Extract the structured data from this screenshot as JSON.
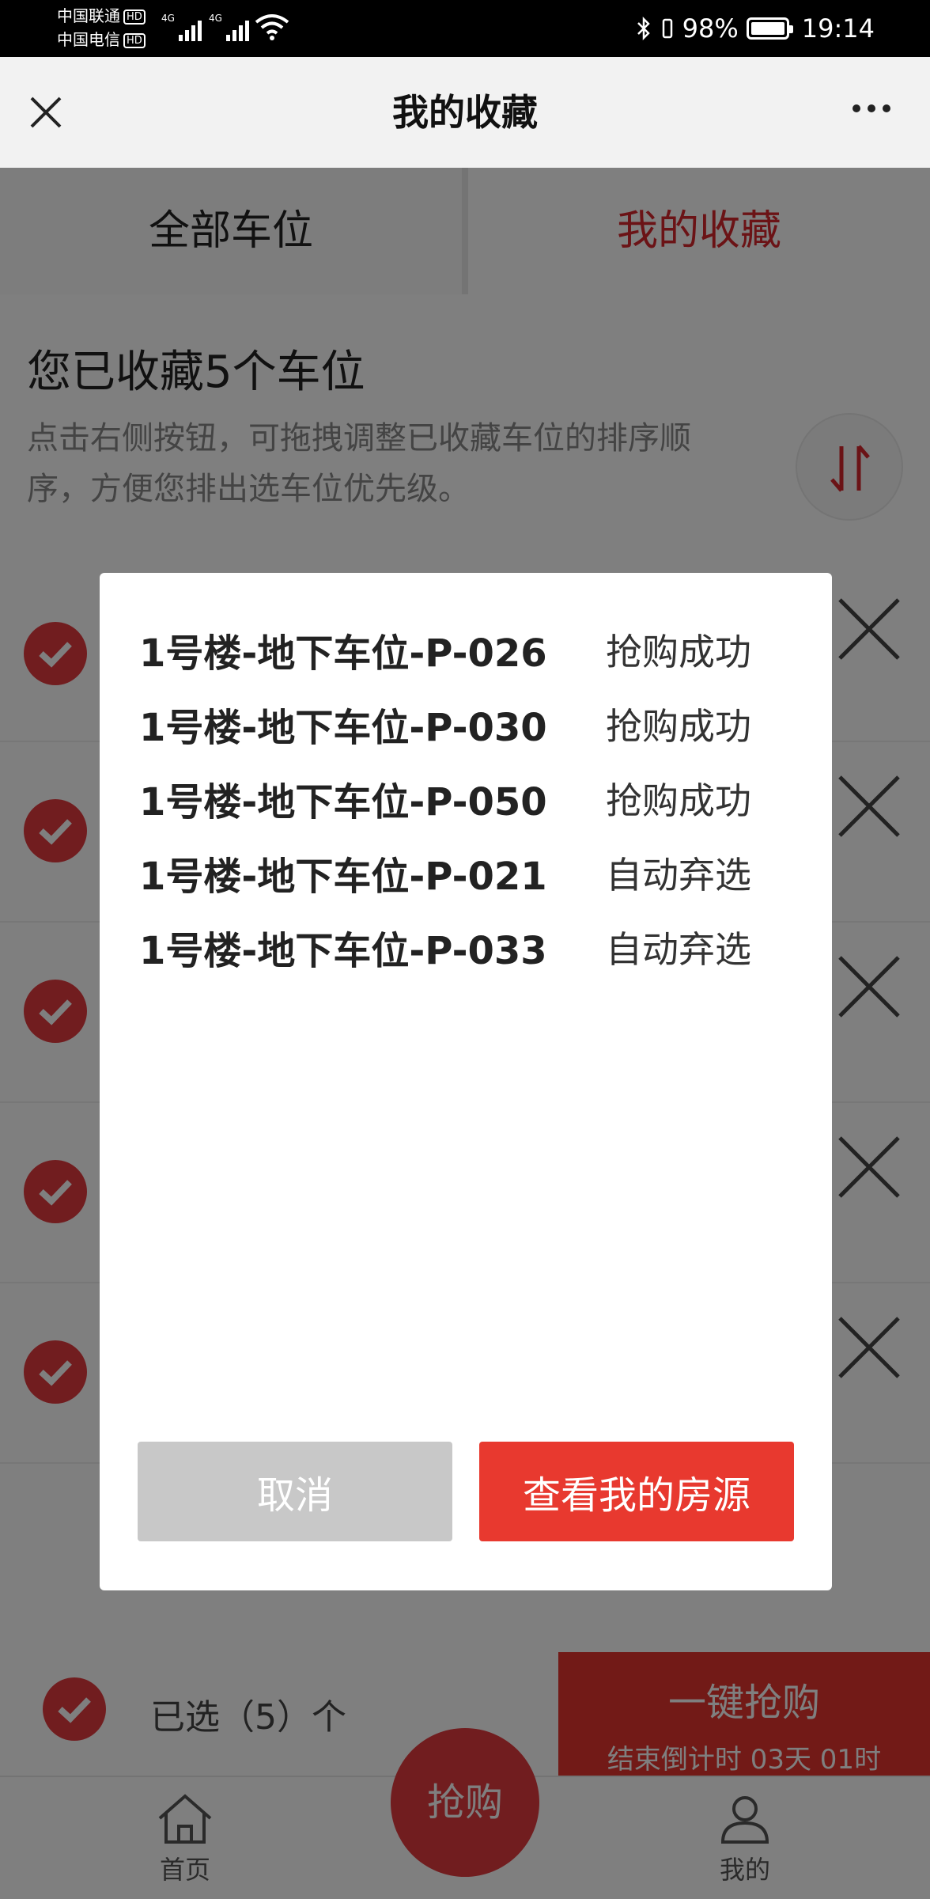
{
  "status_bar": {
    "carrier1": "中国联通",
    "carrier2": "中国电信",
    "hd": "HD",
    "network": "4G",
    "battery": "98%",
    "time": "19:14"
  },
  "titlebar": {
    "title": "我的收藏"
  },
  "tabs": [
    {
      "label": "全部车位"
    },
    {
      "label": "我的收藏"
    }
  ],
  "info": {
    "title": "您已收藏5个车位",
    "desc": "点击右侧按钮，可拖拽调整已收藏车位的排序顺序，方便您排出选车位优先级。"
  },
  "footer": {
    "selected": "已选（5）个",
    "grab_all": "一键抢购",
    "countdown": "结束倒计时 03天 01时"
  },
  "bottom_nav": {
    "home": "首页",
    "grab": "抢购",
    "mine": "我的"
  },
  "dialog": {
    "results": [
      {
        "spot": "1号楼-地下车位-P-026",
        "status": "抢购成功"
      },
      {
        "spot": "1号楼-地下车位-P-030",
        "status": "抢购成功"
      },
      {
        "spot": "1号楼-地下车位-P-050",
        "status": "抢购成功"
      },
      {
        "spot": "1号楼-地下车位-P-021",
        "status": "自动弃选"
      },
      {
        "spot": "1号楼-地下车位-P-033",
        "status": "自动弃选"
      }
    ],
    "cancel_label": "取消",
    "view_label": "查看我的房源"
  },
  "colors": {
    "accent": "#e23a3f",
    "button_red": "#e8392f",
    "button_gray": "#c8c8c8"
  }
}
